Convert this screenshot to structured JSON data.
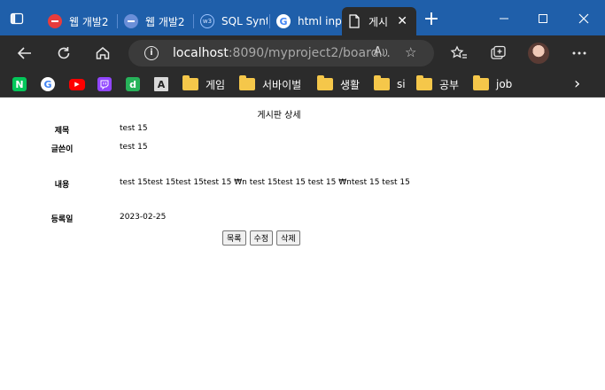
{
  "browser": {
    "tabs": [
      {
        "title": "웹 개발2",
        "favicon": "red-circle-favicon"
      },
      {
        "title": "웹 개발2",
        "favicon": "blue-circle-favicon"
      },
      {
        "title": "SQL Synt",
        "favicon": "w3schools-favicon"
      },
      {
        "title": "html inp",
        "favicon": "google-favicon"
      },
      {
        "title": "게시",
        "favicon": "document-favicon",
        "active": true
      }
    ],
    "address": {
      "host": "localhost",
      "rest": ":8090/myproject2/board..."
    },
    "bookmarks": [
      {
        "label": "",
        "icon": "naver-icon",
        "glyph": "N",
        "color": "#03c75a"
      },
      {
        "label": "",
        "icon": "google-icon",
        "glyph": "G",
        "color": "#ffffff"
      },
      {
        "label": "",
        "icon": "youtube-icon",
        "glyph": "▶",
        "color": "#ff0000"
      },
      {
        "label": "",
        "icon": "twitch-icon",
        "glyph": "◩",
        "color": "#9146ff"
      },
      {
        "label": "",
        "icon": "daum-icon",
        "glyph": "d",
        "color": "#27b35a"
      },
      {
        "label": "",
        "icon": "a-logo-icon",
        "glyph": "A",
        "color": "#d9d9d9"
      },
      {
        "label": "게임",
        "icon": "folder-icon"
      },
      {
        "label": "서바이벌",
        "icon": "folder-icon"
      },
      {
        "label": "생활",
        "icon": "folder-icon"
      },
      {
        "label": "si",
        "icon": "folder-icon"
      },
      {
        "label": "공부",
        "icon": "folder-icon"
      },
      {
        "label": "job",
        "icon": "folder-icon"
      }
    ]
  },
  "board": {
    "heading": "게시판 상세",
    "fields": [
      {
        "label": "제목",
        "value": "test 15"
      },
      {
        "label": "글쓴이",
        "value": "test 15"
      },
      {
        "label": "내용",
        "value": "test 15test 15test 15test 15 ₩n test 15test 15 test 15 ₩ntest 15 test 15"
      },
      {
        "label": "등록일",
        "value": "2023-02-25"
      }
    ],
    "buttons": {
      "list": "목록",
      "edit": "수정",
      "delete": "삭제"
    }
  }
}
